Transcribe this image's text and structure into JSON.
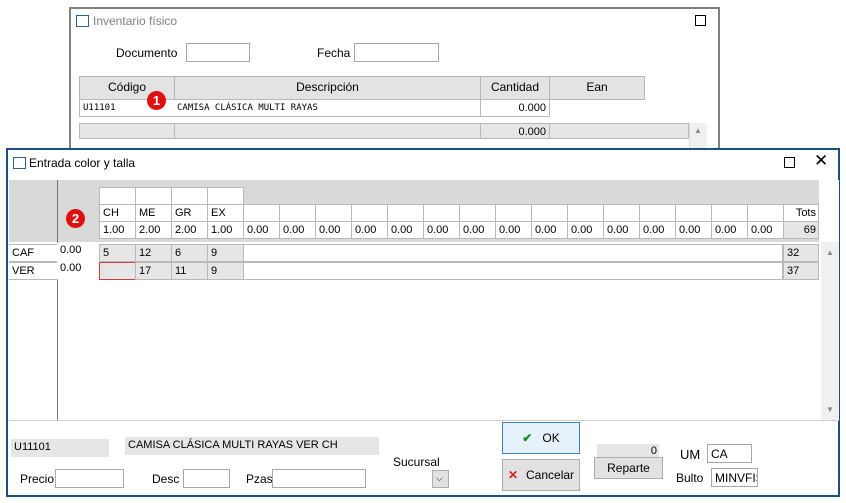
{
  "back_window": {
    "title": "Inventario físico",
    "documento_label": "Documento",
    "fecha_label": "Fecha",
    "columns": [
      "Código",
      "Descripción",
      "Cantidad",
      "Ean"
    ],
    "row": {
      "codigo": "U11101",
      "descripcion": "CAMISA CLÁSICA MULTI RAYAS",
      "cantidad": "0.000"
    },
    "total": "0.000",
    "badge": "1"
  },
  "dialog": {
    "title": "Entrada color y talla",
    "badge": "2",
    "sizes": [
      "CH",
      "ME",
      "GR",
      "EX"
    ],
    "factors": [
      "1.00",
      "2.00",
      "2.00",
      "1.00",
      "0.00",
      "0.00",
      "0.00",
      "0.00",
      "0.00",
      "0.00",
      "0.00",
      "0.00",
      "0.00",
      "0.00",
      "0.00",
      "0.00",
      "0.00",
      "0.00",
      "0.00"
    ],
    "tots_label": "Tots",
    "tots_total": "69",
    "rows": [
      {
        "color": "CAF",
        "price": "0.00",
        "values": [
          "5",
          "12",
          "6",
          "9"
        ],
        "tot": "32"
      },
      {
        "color": "VER",
        "price": "0.00",
        "values": [
          "",
          "17",
          "11",
          "9"
        ],
        "tot": "37"
      }
    ],
    "footer": {
      "code": "U11101",
      "description": "CAMISA CLÁSICA MULTI RAYAS VER CH",
      "precio_label": "Precio",
      "desc_label": "Desc",
      "pzas_label": "Pzas",
      "sucursal_label": "Sucursal",
      "ok_label": "OK",
      "cancel_label": "Cancelar",
      "reparte_value": "0",
      "reparte_label": "Reparte",
      "um_label": "UM",
      "um_value": "CA",
      "bulto_label": "Bulto",
      "bulto_value": "MINVFIS"
    }
  }
}
